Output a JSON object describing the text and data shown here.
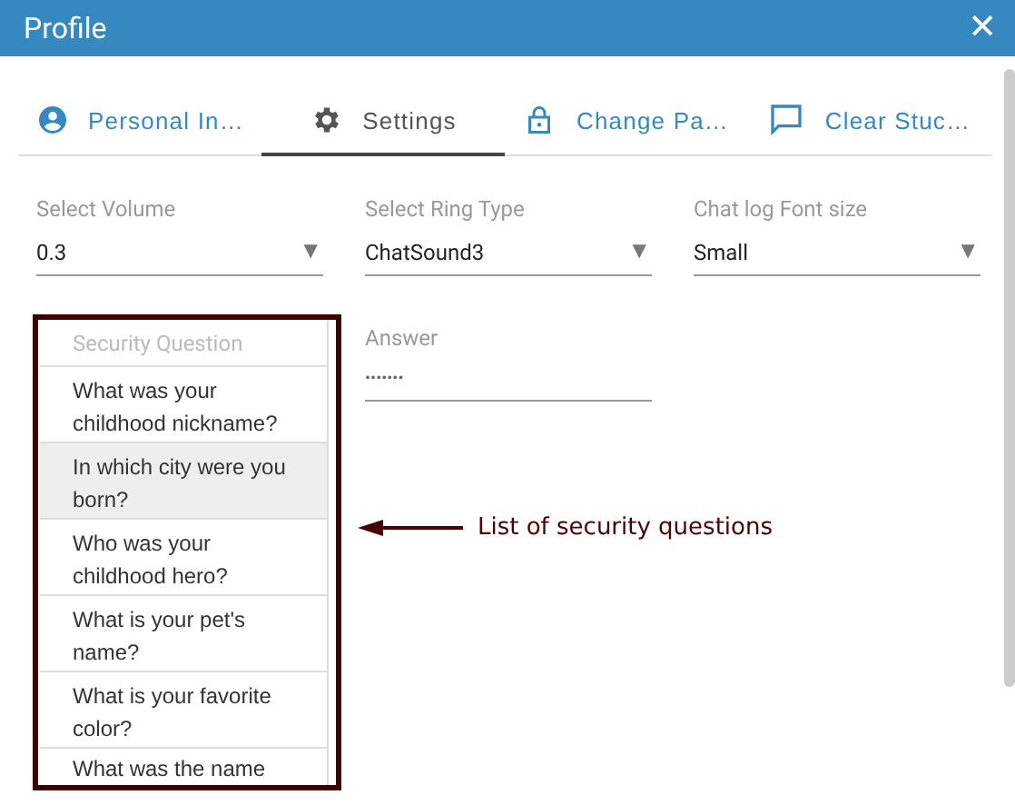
{
  "window": {
    "title": "Profile",
    "close": "✕"
  },
  "tabs": [
    {
      "label": "Personal In…",
      "kind": "person",
      "selected": false
    },
    {
      "label": "Settings",
      "kind": "gear",
      "selected": true
    },
    {
      "label": "Change Pa…",
      "kind": "lock",
      "selected": false
    },
    {
      "label": "Clear Stuc…",
      "kind": "chat",
      "selected": false
    }
  ],
  "selects": [
    {
      "label": "Select Volume",
      "value": "0.3",
      "caret": "▼"
    },
    {
      "label": "Select Ring Type",
      "value": "ChatSound3",
      "caret": "▼"
    },
    {
      "label": "Chat log Font size",
      "value": "Small",
      "caret": "▼"
    }
  ],
  "security_question": {
    "header": "Security Question",
    "items": [
      {
        "text": "What was your childhood nickname?",
        "selected": false
      },
      {
        "text": "In which city were you born?",
        "selected": true
      },
      {
        "text": "Who was your childhood hero?",
        "selected": false
      },
      {
        "text": "What is your pet's name?",
        "selected": false
      },
      {
        "text": "What is your favorite color?",
        "selected": false
      },
      {
        "text": "What was the name",
        "selected": false
      }
    ]
  },
  "answer": {
    "label": "Answer",
    "value": "•••••••"
  },
  "annotation": {
    "text": "List of security questions"
  }
}
